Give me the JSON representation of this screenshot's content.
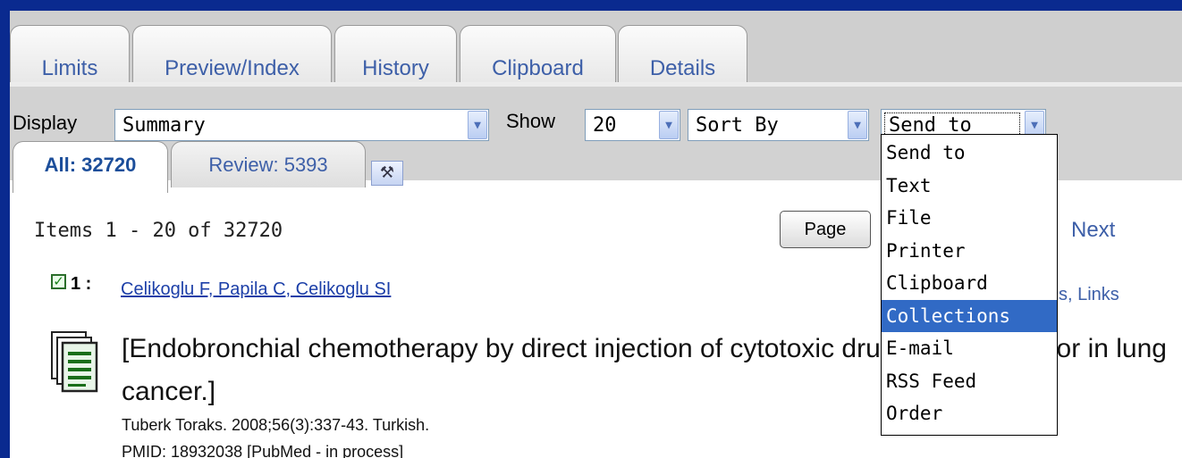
{
  "top_tabs": [
    "Limits",
    "Preview/Index",
    "History",
    "Clipboard",
    "Details"
  ],
  "toolbar": {
    "display_label": "Display",
    "display_value": "Summary",
    "show_label": "Show",
    "show_value": "20",
    "sort_value": "Sort By",
    "send_value": "Send to"
  },
  "sub_tabs": {
    "all": "All: 32720",
    "review": "Review: 5393"
  },
  "results": {
    "items_count": "Items 1 - 20 of 32720",
    "page_button": "Page",
    "next_link": "Next",
    "links_partial": "s, Links"
  },
  "item": {
    "number": "1 :",
    "authors": "Celikoglu F, Papila C, Celikoglu SI",
    "title": "[Endobronchial chemotherapy by direct injection of cytotoxic drugs into the tumor in lung cancer.]",
    "citation": "Tuberk Toraks. 2008;56(3):337-43. Turkish.",
    "pmid": "PMID: 18932038 [PubMed - in process]"
  },
  "send_to_menu": [
    "Send to",
    "Text",
    "File",
    "Printer",
    "Clipboard",
    "Collections",
    "E-mail",
    "RSS Feed",
    "Order"
  ],
  "highlighted_option": "Collections",
  "colors": {
    "outer_border": "#0a2a8f",
    "link_blue": "#3d5fa8",
    "highlight": "#316ac5"
  }
}
